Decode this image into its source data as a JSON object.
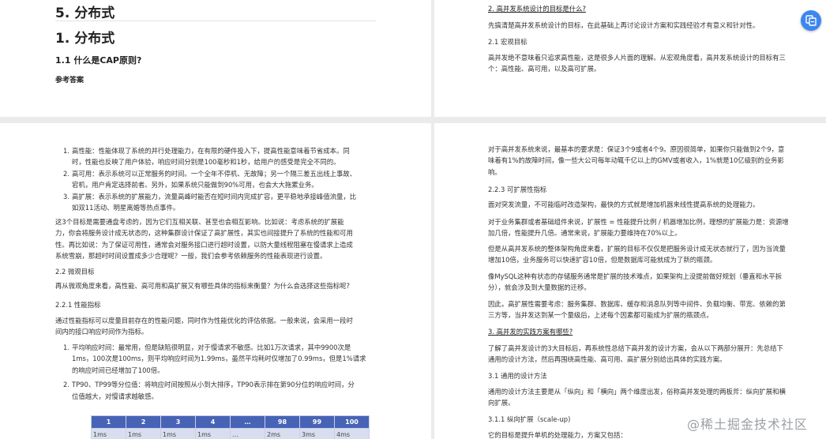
{
  "page1": {
    "title5": "5. 分布式",
    "title1": "1. 分布式",
    "h11": "1.1 什么是CAP原则?",
    "answer": "参考答案"
  },
  "page2": {
    "q2": "2. 高并发系统设计的目标是什么?",
    "p1": "先搞清楚高并发系统设计的目标，在此基础上再讨论设计方案和实践经验才有意义和针对性。",
    "h21": "2.1 宏观目标",
    "p2a": "高并发绝不意味着只追求高性能，这是很多人片面的理解。从宏观角度看，高并发系统设计的目标有三",
    "p2b": "个：高性能、高可用，以及高可扩展。"
  },
  "page3": {
    "list": [
      {
        "num": "1.",
        "lines": [
          "高性能：性能体现了系统的并行处理能力，在有限的硬件投入下，提高性能意味着节省成本。同",
          "时，性能也反映了用户体验，响应时间分别是100毫秒和1秒，给用户的感受是完全不同的。"
        ]
      },
      {
        "num": "2.",
        "lines": [
          "高可用：表示系统可以正常服务的时间。一个全年不停机、无故障；另一个隔三差五出线上事故、",
          "宕机，用户肯定选择前者。另外，如果系统只能做到90%可用，也会大大拖累业务。"
        ]
      },
      {
        "num": "3.",
        "lines": [
          "高扩展：表示系统的扩展能力，流量高峰时能否在短时间内完成扩容，更平稳地承接峰值流量，比",
          "如双11活动、明星离婚等热点事件。"
        ]
      }
    ],
    "para": [
      "这3个目标是需要通盘考虑的，因为它们互相关联、甚至也会相互影响。比如说：考虑系统的扩展能",
      "力，你会将服务设计成无状态的，这种集群设计保证了高扩展性，其实也间接提升了系统的性能和可用",
      "性。再比如说：为了保证可用性，通常会对服务接口进行超时设置，以防大量线程阻塞在慢请求上造成",
      "系统雪崩，那超时时间设置成多少合理呢？一般，我们会参考依赖服务的性能表现进行设置。"
    ],
    "h22": "2.2 微观目标",
    "p22": "再从微观角度来看，高性能、高可用和高扩展又有哪些具体的指标来衡量？为什么会选择这些指标呢?",
    "h221": "2.2.1 性能指标",
    "p221": [
      "通过性能指标可以度量目前存在的性能问题，同时作为性能优化的评估依据。一般来说，会采用一段时",
      "间内的接口响应时间作为指标。"
    ],
    "list2": [
      {
        "num": "1.",
        "lines": [
          "平均响应时间：最常用，但是缺陷很明显，对于慢请求不敏感。比如1万次请求，其中9900次是",
          "1ms，100次是100ms，则平均响应时间为1.99ms，虽然平均耗时仅增加了0.99ms，但是1%请求",
          "的响应时间已经增加了100倍。"
        ]
      },
      {
        "num": "2.",
        "lines": [
          "TP90、TP99等分位值：将响应时间按照从小到大排序，TP90表示排在第90分位的响应时间，分",
          "位值越大，对慢请求越敏感。"
        ]
      }
    ],
    "table": {
      "head": [
        "1",
        "2",
        "3",
        "4",
        "…",
        "98",
        "99",
        "100"
      ],
      "row": [
        "1ms",
        "1ms",
        "1ms",
        "1ms",
        "…",
        "2ms",
        "3ms",
        "4ms"
      ]
    }
  },
  "page4": {
    "p1": [
      "对于高并发系统来说，最基本的要求是：保证3个9或者4个9。原因很简单，如果你只能做到2个9，意",
      "味着有1%的故障时间，像一些大公司每年动辄千亿以上的GMV或者收入，1%就是10亿级别的业务影",
      "响。"
    ],
    "h223": "2.2.3 可扩展性指标",
    "p2": "面对突发流量，不可能临时改造架构，最快的方式就是增加机器来线性提高系统的处理能力。",
    "p3": [
      "对于业务集群或者基础组件来说，扩展性 = 性能提升比例 / 机器增加比例，理想的扩展能力是：资源增",
      "加几倍，性能提升几倍。通常来说，扩展能力要维持在70%以上。"
    ],
    "p4": [
      "但是从高并发系统的整体架构角度来看，扩展的目标不仅仅是把服务设计成无状态就行了，因为当流量",
      "增加10倍，业务服务可以快速扩容10倍，但是数据库可能就成为了新的瓶颈。"
    ],
    "p5": [
      "像MySQL这种有状态的存储服务通常是扩展的技术难点，如果架构上没提前做好规划（垂直和水平拆",
      "分），就会涉及到大量数据的迁移。"
    ],
    "p6": [
      "因此，高扩展性需要考虑：服务集群、数据库、缓存和消息队列等中间件、负载均衡、带宽、依赖的第",
      "三方等，当并发达到某一个量级后，上述每个因素都可能成为扩展的瓶颈点。"
    ],
    "q3": "3. 高并发的实践方案有哪些?",
    "p7": [
      "了解了高并发设计的3大目标后，再系统性总结下高并发的设计方案，会从以下两部分展开：先总结下",
      "通用的设计方法，然后再围绕高性能、高可用、高扩展分别给出具体的实践方案。"
    ],
    "h31": "3.1 通用的设计方法",
    "p8": [
      "通用的设计方法主要是从「纵向」和「横向」两个维度出发，俗称高并发处理的两板斧：纵向扩展和横",
      "向扩展。"
    ],
    "h311": "3.1.1 纵向扩展（scale-up)",
    "p9": "它的目标是提升单机的处理能力，方案又包括："
  },
  "watermark": "@稀土掘金技术社区",
  "colors": {
    "table_head": "#4763b6",
    "table_row": "#d8deef",
    "fab": "#3d86f0"
  }
}
